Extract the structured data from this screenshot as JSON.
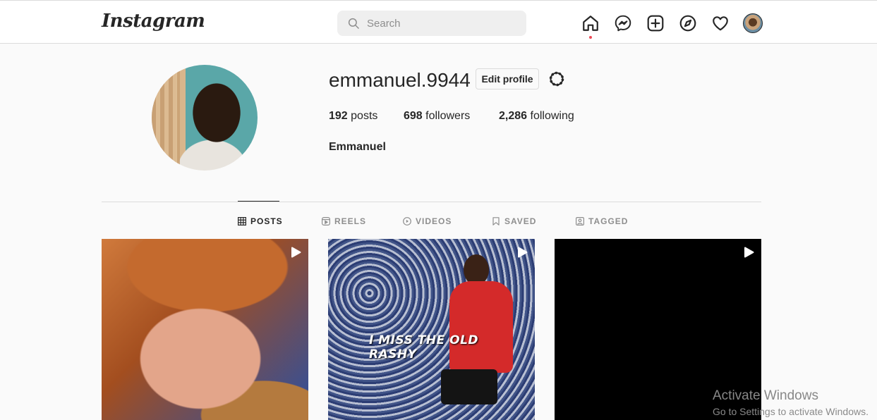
{
  "header": {
    "logo": "Instagram",
    "search": {
      "placeholder": "Search",
      "value": ""
    },
    "nav_icons": [
      "home-icon",
      "messenger-icon",
      "new-post-icon",
      "explore-icon",
      "activity-heart-icon",
      "profile-avatar"
    ]
  },
  "profile": {
    "username": "emmanuel.9944",
    "edit_label": "Edit profile",
    "stats": {
      "posts_count": "192",
      "posts_label": " posts",
      "followers_count": "698",
      "followers_label": " followers",
      "following_count": "2,286",
      "following_label": " following"
    },
    "full_name": "Emmanuel"
  },
  "tabs": [
    {
      "label": "POSTS",
      "icon": "grid-icon",
      "active": true
    },
    {
      "label": "REELS",
      "icon": "reels-icon",
      "active": false
    },
    {
      "label": "VIDEOS",
      "icon": "video-play-icon",
      "active": false
    },
    {
      "label": "SAVED",
      "icon": "bookmark-icon",
      "active": false
    },
    {
      "label": "TAGGED",
      "icon": "tagged-icon",
      "active": false
    }
  ],
  "posts": [
    {
      "type": "reel",
      "caption": ""
    },
    {
      "type": "reel",
      "caption": "I MISS THE OLD RASHY"
    },
    {
      "type": "reel",
      "caption": ""
    }
  ],
  "watermark": {
    "line1": "Activate Windows",
    "line2": "Go to Settings to activate Windows."
  },
  "colors": {
    "background": "#fafafa",
    "text": "#262626",
    "muted": "#8e8e8e",
    "border": "#dbdbdb",
    "notification_dot": "#ed4956"
  }
}
